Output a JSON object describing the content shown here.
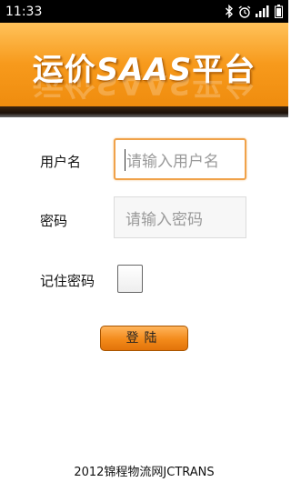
{
  "status_bar": {
    "time": "11:33",
    "icons": [
      "bluetooth-icon",
      "alarm-icon",
      "signal-icon",
      "battery-icon"
    ]
  },
  "banner": {
    "title_cjk_prefix": "运价",
    "title_latin": "SAAS",
    "title_cjk_suffix": "平台",
    "title_full": "运价SAAS平台"
  },
  "form": {
    "username_label": "用户名",
    "username_placeholder": "请输入用户名",
    "password_label": "密码",
    "password_placeholder": "请输入密码",
    "remember_label": "记住密码",
    "remember_checked": false,
    "login_label": "登陆"
  },
  "footer": {
    "text": "2012锦程物流网JCTRANS"
  },
  "colors": {
    "accent_orange": "#f38a1a",
    "focus_border": "#f0a24a",
    "status_bar_bg": "#000000"
  }
}
